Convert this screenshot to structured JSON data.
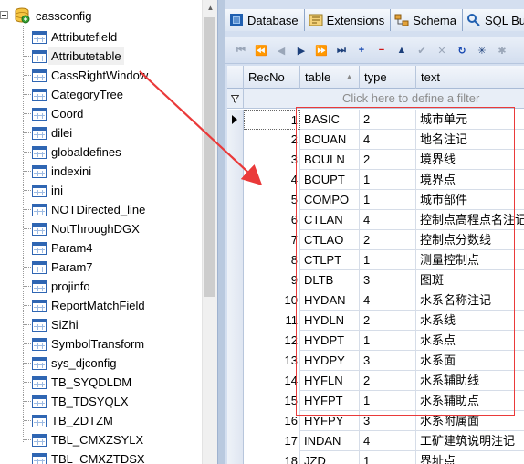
{
  "tree": {
    "root_label": "cassconfig",
    "selected_index": 1,
    "items": [
      "Attributefield",
      "Attributetable",
      "CassRightWindow",
      "CategoryTree",
      "Coord",
      "dilei",
      "globaldefines",
      "indexini",
      "ini",
      "NOTDirected_line",
      "NotThroughDGX",
      "Param4",
      "Param7",
      "projinfo",
      "ReportMatchField",
      "SiZhi",
      "SymbolTransform",
      "sys_djconfig",
      "TB_SYQDLDM",
      "TB_TDSYQLX",
      "TB_ZDTZM",
      "TBL_CMXZSYLX",
      "TBL_CMXZTDSX"
    ]
  },
  "tabs": [
    {
      "label": "Database",
      "icon": "database-icon"
    },
    {
      "label": "Extensions",
      "icon": "extensions-icon"
    },
    {
      "label": "Schema",
      "icon": "schema-icon"
    },
    {
      "label": "SQL Bu",
      "icon": "sql-builder-icon"
    }
  ],
  "navigator": [
    {
      "glyph": "⏮",
      "name": "first-record-button",
      "style": "dis"
    },
    {
      "glyph": "⏪",
      "name": "prior-page-button",
      "style": "dis"
    },
    {
      "glyph": "◀",
      "name": "prior-record-button",
      "style": "dis"
    },
    {
      "glyph": "▶",
      "name": "next-record-button",
      "style": ""
    },
    {
      "glyph": "⏩",
      "name": "next-page-button",
      "style": ""
    },
    {
      "glyph": "⏭",
      "name": "last-record-button",
      "style": ""
    },
    {
      "glyph": "+",
      "name": "insert-record-button",
      "style": "blue"
    },
    {
      "glyph": "−",
      "name": "delete-record-button",
      "style": "red"
    },
    {
      "glyph": "▲",
      "name": "edit-record-button",
      "style": ""
    },
    {
      "glyph": "✔",
      "name": "post-edit-button",
      "style": "dis"
    },
    {
      "glyph": "✕",
      "name": "cancel-edit-button",
      "style": "dis"
    },
    {
      "glyph": "↻",
      "name": "refresh-button",
      "style": "blue"
    },
    {
      "glyph": "✳",
      "name": "bookmark-button",
      "style": ""
    },
    {
      "glyph": "✱",
      "name": "goto-bookmark-button",
      "style": "dis"
    }
  ],
  "grid": {
    "columns": {
      "recno": "RecNo",
      "table": "table",
      "type": "type",
      "text": "text"
    },
    "sort_indicator": "▲",
    "filter_placeholder": "Click here to define a filter",
    "current_row": 0,
    "rows": [
      {
        "recno": "1",
        "table": "BASIC",
        "type": "2",
        "text": "城市单元"
      },
      {
        "recno": "2",
        "table": "BOUAN",
        "type": "4",
        "text": "地名注记"
      },
      {
        "recno": "3",
        "table": "BOULN",
        "type": "2",
        "text": "境界线"
      },
      {
        "recno": "4",
        "table": "BOUPT",
        "type": "1",
        "text": "境界点"
      },
      {
        "recno": "5",
        "table": "COMPO",
        "type": "1",
        "text": "城市部件"
      },
      {
        "recno": "6",
        "table": "CTLAN",
        "type": "4",
        "text": "控制点高程点名注记"
      },
      {
        "recno": "7",
        "table": "CTLAO",
        "type": "2",
        "text": "控制点分数线"
      },
      {
        "recno": "8",
        "table": "CTLPT",
        "type": "1",
        "text": "测量控制点"
      },
      {
        "recno": "9",
        "table": "DLTB",
        "type": "3",
        "text": "图斑"
      },
      {
        "recno": "10",
        "table": "HYDAN",
        "type": "4",
        "text": "水系名称注记"
      },
      {
        "recno": "11",
        "table": "HYDLN",
        "type": "2",
        "text": "水系线"
      },
      {
        "recno": "12",
        "table": "HYDPT",
        "type": "1",
        "text": "水系点"
      },
      {
        "recno": "13",
        "table": "HYDPY",
        "type": "3",
        "text": "水系面"
      },
      {
        "recno": "14",
        "table": "HYFLN",
        "type": "2",
        "text": "水系辅助线"
      },
      {
        "recno": "15",
        "table": "HYFPT",
        "type": "1",
        "text": "水系辅助点"
      },
      {
        "recno": "16",
        "table": "HYFPY",
        "type": "3",
        "text": "水系附属面"
      },
      {
        "recno": "17",
        "table": "INDAN",
        "type": "4",
        "text": "工矿建筑说明注记"
      },
      {
        "recno": "18",
        "table": "JZD",
        "type": "1",
        "text": "界址点"
      }
    ]
  },
  "colors": {
    "annotation_red": "#ea3a3a",
    "tree_selection": "#f0f0f0",
    "grid_header": "#dfe7f3",
    "panel_bg": "#d4dff0"
  }
}
